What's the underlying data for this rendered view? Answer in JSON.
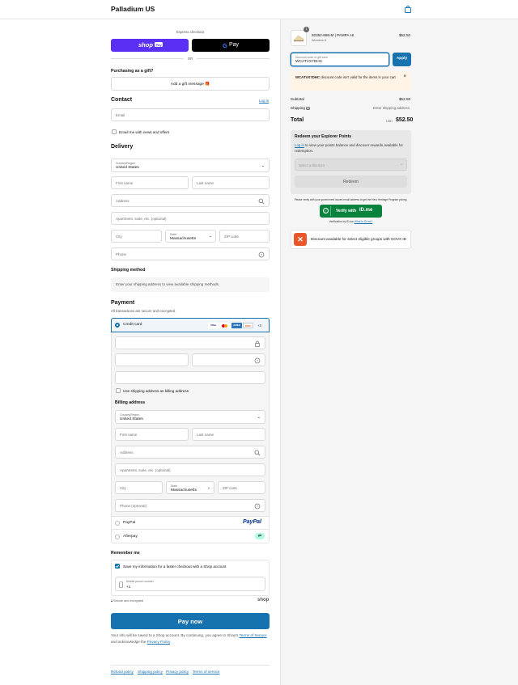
{
  "brand": "Palladium US",
  "express": {
    "title": "Express checkout",
    "shop_label": "shop",
    "shop_pay_label": "Pay",
    "gpay_label": "Pay",
    "or": "OR"
  },
  "gift": {
    "title": "Purchasing as a gift?",
    "button": "Add a gift message"
  },
  "contact": {
    "title": "Contact",
    "login": "Log in",
    "email_placeholder": "Email",
    "news_label": "Email me with news and offers"
  },
  "delivery": {
    "title": "Delivery",
    "country_label": "Country/Region",
    "country_value": "United States",
    "first_name": "First name",
    "last_name": "Last name",
    "address": "Address",
    "apartment": "Apartment, suite, etc. (optional)",
    "city": "City",
    "state_label": "State",
    "state_value": "Massachusetts",
    "zip": "ZIP code",
    "phone": "Phone"
  },
  "shipping": {
    "title": "Shipping method",
    "note": "Enter your shipping address to view available shipping methods."
  },
  "payment": {
    "title": "Payment",
    "subtitle": "All transactions are secure and encrypted.",
    "credit_card": "Credit card",
    "more_cards": "+3",
    "cards": [
      "VISA",
      "MC",
      "AMEX",
      "DISC"
    ],
    "use_shipping": "Use shipping address as billing address",
    "billing_title": "Billing address",
    "billing": {
      "country_label": "Country/Region",
      "country_value": "United States",
      "first_name": "First name",
      "last_name": "Last name",
      "address": "Address",
      "apartment": "Apartment, suite, etc. (optional)",
      "city": "City",
      "state_label": "State",
      "state_value": "Massachusetts",
      "zip": "ZIP code",
      "phone": "Phone (optional)"
    },
    "paypal": "PayPal",
    "paypal_logo": "PayPal",
    "afterpay": "Afterpay"
  },
  "remember": {
    "title": "Remember me",
    "save_label": "Save my information for a faster checkout with a Shop account",
    "mobile_label": "Mobile phone number",
    "mobile_value": "+1",
    "secure": "Secure and encrypted",
    "shop": "shop"
  },
  "pay_now": "Pay now",
  "legal": {
    "text1": "Your info will be saved to a Shop account. By continuing, you agree to Shop's",
    "terms": "Terms of Service",
    "text2": "and acknowledge the",
    "privacy": "Privacy Policy",
    "period": "."
  },
  "footer": [
    "Refund policy",
    "Shipping policy",
    "Privacy policy",
    "Terms of service"
  ],
  "order": {
    "qty": "1",
    "item_name": "92352-868-M | PAMPA HI",
    "item_variant": "Womens 6",
    "item_price": "$52.50",
    "discount_label": "Discount code or gift card",
    "discount_value": "WCATVX7DHC",
    "apply": "Apply",
    "error_code": "WCATVX7DHC",
    "error_text": "discount code isn't valid for the items in your cart",
    "subtotal_label": "Subtotal",
    "subtotal": "$52.50",
    "shipping_label": "Shipping",
    "shipping_value": "Enter shipping address",
    "total_label": "Total",
    "currency": "USD",
    "total": "$52.50"
  },
  "rewards": {
    "title": "Redeem your Explorer Points",
    "login": "Log in",
    "text": "to view your points balance and discover rewards available for redemption.",
    "select_placeholder": "Select a discount",
    "redeem": "Redeem"
  },
  "idme": {
    "note": "Please verify with your government issued email address to get the Hero Heritage Program pricing.",
    "button": "Verify with",
    "logo": "ID.me",
    "verified_by": "Verification by ID.me",
    "what_is": "What is ID.me?"
  },
  "govx": {
    "text": "Discount available for select eligible groups with GOVX ID"
  },
  "colors": {
    "accent": "#1773b0",
    "shop_purple": "#5a31f4",
    "idme_green": "#08833d",
    "error_bg": "#fff4e6"
  }
}
